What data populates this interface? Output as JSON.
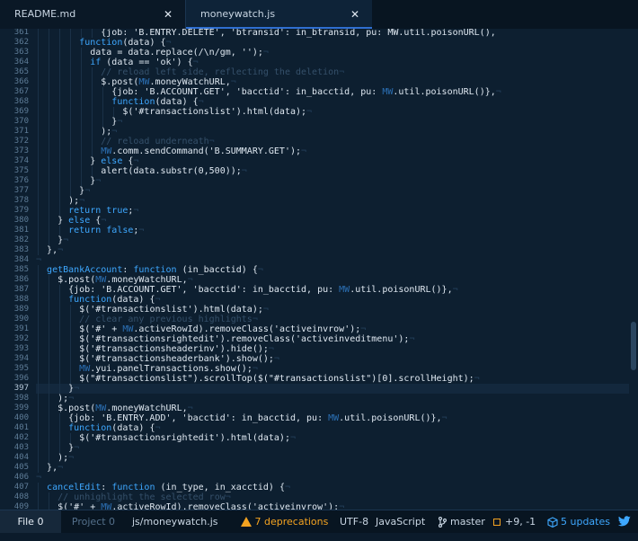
{
  "tabs": [
    {
      "label": "README.md",
      "close": "✕"
    },
    {
      "label": "moneywatch.js",
      "close": "✕"
    }
  ],
  "editor": {
    "current_line": 397,
    "lines": [
      {
        "num": 361,
        "indent": 12,
        "tokens": [
          [
            "s",
            "{job: 'B.ENTRY.DELETE', 'btransid': in_btransid, pu: MW.util.poisonURL(),"
          ]
        ]
      },
      {
        "num": 362,
        "indent": 8,
        "tokens": [
          [
            "k",
            "function"
          ],
          [
            "s",
            "(data) {"
          ],
          [
            "w",
            "¬"
          ]
        ]
      },
      {
        "num": 363,
        "indent": 10,
        "tokens": [
          [
            "s",
            "data = data.replace(/\\n/gm, '');"
          ],
          [
            "w",
            "¬"
          ]
        ]
      },
      {
        "num": 364,
        "indent": 10,
        "tokens": [
          [
            "k",
            "if"
          ],
          [
            "s",
            " (data == 'ok') {"
          ],
          [
            "w",
            "¬"
          ]
        ]
      },
      {
        "num": 365,
        "indent": 12,
        "tokens": [
          [
            "c",
            "// reload left side, reflecting the deletion"
          ],
          [
            "w",
            "¬"
          ]
        ]
      },
      {
        "num": 366,
        "indent": 12,
        "tokens": [
          [
            "s",
            "$.post("
          ],
          [
            "v",
            "MW"
          ],
          [
            "s",
            ".moneyWatchURL,"
          ],
          [
            "w",
            "¬"
          ]
        ]
      },
      {
        "num": 367,
        "indent": 14,
        "tokens": [
          [
            "s",
            "{job: 'B.ACCOUNT.GET', 'bacctid': in_bacctid, pu: "
          ],
          [
            "v",
            "MW"
          ],
          [
            "s",
            ".util.poisonURL()},"
          ],
          [
            "w",
            "¬"
          ]
        ]
      },
      {
        "num": 368,
        "indent": 14,
        "tokens": [
          [
            "k",
            "function"
          ],
          [
            "s",
            "(data) {"
          ],
          [
            "w",
            "¬"
          ]
        ]
      },
      {
        "num": 369,
        "indent": 16,
        "tokens": [
          [
            "s",
            "$('#transactionslist').html(data);"
          ],
          [
            "w",
            "¬"
          ]
        ]
      },
      {
        "num": 370,
        "indent": 14,
        "tokens": [
          [
            "s",
            "}"
          ],
          [
            "w",
            "¬"
          ]
        ]
      },
      {
        "num": 371,
        "indent": 12,
        "tokens": [
          [
            "s",
            ");"
          ],
          [
            "w",
            "¬"
          ]
        ]
      },
      {
        "num": 372,
        "indent": 12,
        "tokens": [
          [
            "c",
            "// reload underneath"
          ],
          [
            "w",
            "¬"
          ]
        ]
      },
      {
        "num": 373,
        "indent": 12,
        "tokens": [
          [
            "v",
            "MW"
          ],
          [
            "s",
            ".comm.sendCommand('B.SUMMARY.GET');"
          ],
          [
            "w",
            "¬"
          ]
        ]
      },
      {
        "num": 374,
        "indent": 10,
        "tokens": [
          [
            "s",
            "} "
          ],
          [
            "k",
            "else"
          ],
          [
            "s",
            " {"
          ],
          [
            "w",
            "¬"
          ]
        ]
      },
      {
        "num": 375,
        "indent": 12,
        "tokens": [
          [
            "s",
            "alert(data.substr(0,500));"
          ],
          [
            "w",
            "¬"
          ]
        ]
      },
      {
        "num": 376,
        "indent": 10,
        "tokens": [
          [
            "s",
            "}"
          ],
          [
            "w",
            "¬"
          ]
        ]
      },
      {
        "num": 377,
        "indent": 8,
        "tokens": [
          [
            "s",
            "}"
          ],
          [
            "w",
            "¬"
          ]
        ]
      },
      {
        "num": 378,
        "indent": 6,
        "tokens": [
          [
            "s",
            ");"
          ],
          [
            "w",
            "¬"
          ]
        ]
      },
      {
        "num": 379,
        "indent": 6,
        "tokens": [
          [
            "k",
            "return"
          ],
          [
            "s",
            " "
          ],
          [
            "k",
            "true"
          ],
          [
            "s",
            ";"
          ],
          [
            "w",
            "¬"
          ]
        ]
      },
      {
        "num": 380,
        "indent": 4,
        "tokens": [
          [
            "s",
            "} "
          ],
          [
            "k",
            "else"
          ],
          [
            "s",
            " {"
          ],
          [
            "w",
            "¬"
          ]
        ]
      },
      {
        "num": 381,
        "indent": 6,
        "tokens": [
          [
            "k",
            "return"
          ],
          [
            "s",
            " "
          ],
          [
            "k",
            "false"
          ],
          [
            "s",
            ";"
          ],
          [
            "w",
            "¬"
          ]
        ]
      },
      {
        "num": 382,
        "indent": 4,
        "tokens": [
          [
            "s",
            "}"
          ],
          [
            "w",
            "¬"
          ]
        ]
      },
      {
        "num": 383,
        "indent": 2,
        "tokens": [
          [
            "s",
            "},"
          ],
          [
            "w",
            "¬"
          ]
        ]
      },
      {
        "num": 384,
        "indent": 0,
        "tokens": [
          [
            "w",
            "¬"
          ]
        ]
      },
      {
        "num": 385,
        "indent": 2,
        "tokens": [
          [
            "f",
            "getBankAccount"
          ],
          [
            "s",
            ": "
          ],
          [
            "k",
            "function"
          ],
          [
            "s",
            " (in_bacctid) {"
          ],
          [
            "w",
            "¬"
          ]
        ]
      },
      {
        "num": 386,
        "indent": 4,
        "tokens": [
          [
            "s",
            "$.post("
          ],
          [
            "v",
            "MW"
          ],
          [
            "s",
            ".moneyWatchURL,"
          ],
          [
            "w",
            "¬"
          ]
        ]
      },
      {
        "num": 387,
        "indent": 6,
        "tokens": [
          [
            "s",
            "{job: 'B.ACCOUNT.GET', 'bacctid': in_bacctid, pu: "
          ],
          [
            "v",
            "MW"
          ],
          [
            "s",
            ".util.poisonURL()},"
          ],
          [
            "w",
            "¬"
          ]
        ]
      },
      {
        "num": 388,
        "indent": 6,
        "tokens": [
          [
            "k",
            "function"
          ],
          [
            "s",
            "(data) {"
          ],
          [
            "w",
            "¬"
          ]
        ]
      },
      {
        "num": 389,
        "indent": 8,
        "tokens": [
          [
            "s",
            "$('#transactionslist').html(data);"
          ],
          [
            "w",
            "¬"
          ]
        ]
      },
      {
        "num": 390,
        "indent": 8,
        "tokens": [
          [
            "c",
            "// clear any previous highlights"
          ],
          [
            "w",
            "¬"
          ]
        ]
      },
      {
        "num": 391,
        "indent": 8,
        "tokens": [
          [
            "s",
            "$('#' + "
          ],
          [
            "v",
            "MW"
          ],
          [
            "s",
            ".activeRowId).removeClass('activeinvrow');"
          ],
          [
            "w",
            "¬"
          ]
        ]
      },
      {
        "num": 392,
        "indent": 8,
        "tokens": [
          [
            "s",
            "$('#transactionsrightedit').removeClass('activeinveditmenu');"
          ],
          [
            "w",
            "¬"
          ]
        ]
      },
      {
        "num": 393,
        "indent": 8,
        "tokens": [
          [
            "s",
            "$('#transactionsheaderinv').hide();"
          ],
          [
            "w",
            "¬"
          ]
        ]
      },
      {
        "num": 394,
        "indent": 8,
        "tokens": [
          [
            "s",
            "$('#transactionsheaderbank').show();"
          ],
          [
            "w",
            "¬"
          ]
        ]
      },
      {
        "num": 395,
        "indent": 8,
        "tokens": [
          [
            "v",
            "MW"
          ],
          [
            "s",
            ".yui.panelTransactions.show();"
          ],
          [
            "w",
            "¬"
          ]
        ]
      },
      {
        "num": 396,
        "indent": 8,
        "tokens": [
          [
            "s",
            "$(\"#transactionslist\").scrollTop($(\"#transactionslist\")[0].scrollHeight);"
          ],
          [
            "w",
            "¬"
          ]
        ]
      },
      {
        "num": 397,
        "indent": 6,
        "tokens": [
          [
            "s",
            "}"
          ],
          [
            "w",
            "¬"
          ]
        ]
      },
      {
        "num": 398,
        "indent": 4,
        "tokens": [
          [
            "s",
            ");"
          ],
          [
            "w",
            "¬"
          ]
        ]
      },
      {
        "num": 399,
        "indent": 4,
        "tokens": [
          [
            "s",
            "$.post("
          ],
          [
            "v",
            "MW"
          ],
          [
            "s",
            ".moneyWatchURL,"
          ],
          [
            "w",
            "¬"
          ]
        ]
      },
      {
        "num": 400,
        "indent": 6,
        "tokens": [
          [
            "s",
            "{job: 'B.ENTRY.ADD', 'bacctid': in_bacctid, pu: "
          ],
          [
            "v",
            "MW"
          ],
          [
            "s",
            ".util.poisonURL()},"
          ],
          [
            "w",
            "¬"
          ]
        ]
      },
      {
        "num": 401,
        "indent": 6,
        "tokens": [
          [
            "k",
            "function"
          ],
          [
            "s",
            "(data) {"
          ],
          [
            "w",
            "¬"
          ]
        ]
      },
      {
        "num": 402,
        "indent": 8,
        "tokens": [
          [
            "s",
            "$('#transactionsrightedit').html(data);"
          ],
          [
            "w",
            "¬"
          ]
        ]
      },
      {
        "num": 403,
        "indent": 6,
        "tokens": [
          [
            "s",
            "}"
          ],
          [
            "w",
            "¬"
          ]
        ]
      },
      {
        "num": 404,
        "indent": 4,
        "tokens": [
          [
            "s",
            ");"
          ],
          [
            "w",
            "¬"
          ]
        ]
      },
      {
        "num": 405,
        "indent": 2,
        "tokens": [
          [
            "s",
            "},"
          ],
          [
            "w",
            "¬"
          ]
        ]
      },
      {
        "num": 406,
        "indent": 0,
        "tokens": [
          [
            "w",
            "¬"
          ]
        ]
      },
      {
        "num": 407,
        "indent": 2,
        "tokens": [
          [
            "f",
            "cancelEdit"
          ],
          [
            "s",
            ": "
          ],
          [
            "k",
            "function"
          ],
          [
            "s",
            " (in_type, in_xacctid) {"
          ],
          [
            "w",
            "¬"
          ]
        ]
      },
      {
        "num": 408,
        "indent": 4,
        "tokens": [
          [
            "c",
            "// unhighlight the selected row"
          ],
          [
            "w",
            "¬"
          ]
        ]
      },
      {
        "num": 409,
        "indent": 4,
        "tokens": [
          [
            "s",
            "$('#' + "
          ],
          [
            "v",
            "MW"
          ],
          [
            "s",
            ".activeRowId).removeClass('activeinvrow');"
          ],
          [
            "w",
            "¬"
          ]
        ]
      }
    ]
  },
  "status": {
    "file_button": "File 0",
    "project_button": "Project 0",
    "path": "js/moneywatch.js",
    "deprecations": "7 deprecations",
    "encoding": "UTF-8",
    "grammar": "JavaScript",
    "branch": "master",
    "diff": "+9, -1",
    "updates": "5 updates"
  },
  "colors": {
    "background": "#0d1f30",
    "keyword": "#3ea8ff",
    "text": "#dfe8f1",
    "comment": "#35506a",
    "warning": "#f4a321",
    "tab_active_border": "#2f6fd1"
  },
  "icons": {
    "tab_close": "close-icon",
    "warning": "warning-icon",
    "branch": "git-branch-icon",
    "diff": "diff-icon",
    "updates": "package-icon",
    "twitter": "twitter-icon"
  }
}
